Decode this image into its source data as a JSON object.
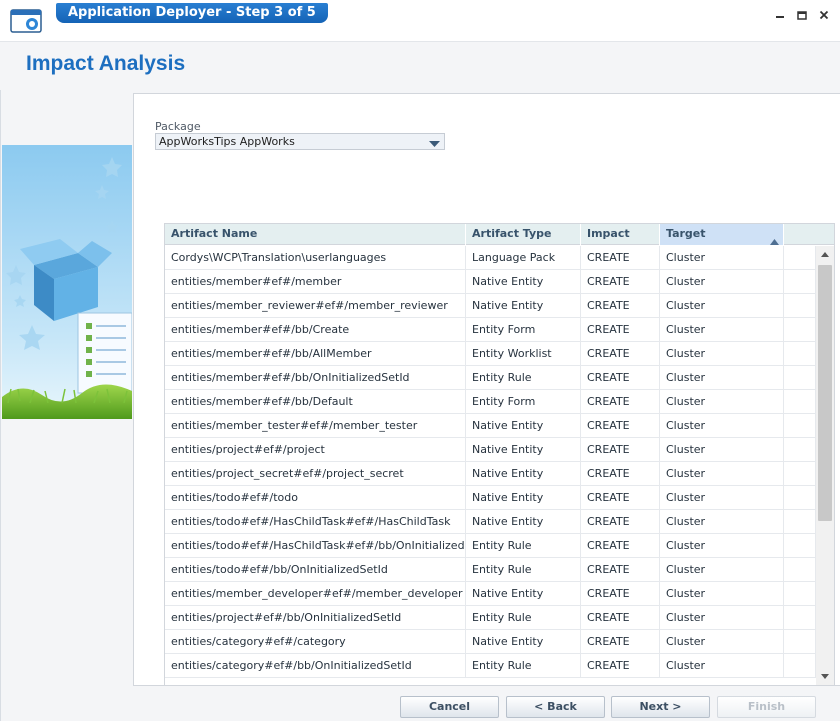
{
  "window": {
    "title": "Application Deployer - Step 3 of 5",
    "icon": "app-window-icon"
  },
  "page": {
    "title": "Impact Analysis"
  },
  "package": {
    "label": "Package",
    "value": "AppWorksTips AppWorks"
  },
  "table": {
    "columns": [
      "Artifact Name",
      "Artifact Type",
      "Impact",
      "Target"
    ],
    "sort": {
      "column": "Target",
      "direction": "ascending"
    },
    "rows": [
      [
        "Cordys\\WCP\\Translation\\userlanguages",
        "Language Pack",
        "CREATE",
        "Cluster"
      ],
      [
        "entities/member#ef#/member",
        "Native Entity",
        "CREATE",
        "Cluster"
      ],
      [
        "entities/member_reviewer#ef#/member_reviewer",
        "Native Entity",
        "CREATE",
        "Cluster"
      ],
      [
        "entities/member#ef#/bb/Create",
        "Entity Form",
        "CREATE",
        "Cluster"
      ],
      [
        "entities/member#ef#/bb/AllMember",
        "Entity Worklist",
        "CREATE",
        "Cluster"
      ],
      [
        "entities/member#ef#/bb/OnInitializedSetId",
        "Entity Rule",
        "CREATE",
        "Cluster"
      ],
      [
        "entities/member#ef#/bb/Default",
        "Entity Form",
        "CREATE",
        "Cluster"
      ],
      [
        "entities/member_tester#ef#/member_tester",
        "Native Entity",
        "CREATE",
        "Cluster"
      ],
      [
        "entities/project#ef#/project",
        "Native Entity",
        "CREATE",
        "Cluster"
      ],
      [
        "entities/project_secret#ef#/project_secret",
        "Native Entity",
        "CREATE",
        "Cluster"
      ],
      [
        "entities/todo#ef#/todo",
        "Native Entity",
        "CREATE",
        "Cluster"
      ],
      [
        "entities/todo#ef#/HasChildTask#ef#/HasChildTask",
        "Native Entity",
        "CREATE",
        "Cluster"
      ],
      [
        "entities/todo#ef#/HasChildTask#ef#/bb/OnInitializedSetId",
        "Entity Rule",
        "CREATE",
        "Cluster"
      ],
      [
        "entities/todo#ef#/bb/OnInitializedSetId",
        "Entity Rule",
        "CREATE",
        "Cluster"
      ],
      [
        "entities/member_developer#ef#/member_developer",
        "Native Entity",
        "CREATE",
        "Cluster"
      ],
      [
        "entities/project#ef#/bb/OnInitializedSetId",
        "Entity Rule",
        "CREATE",
        "Cluster"
      ],
      [
        "entities/category#ef#/category",
        "Native Entity",
        "CREATE",
        "Cluster"
      ],
      [
        "entities/category#ef#/bb/OnInitializedSetId",
        "Entity Rule",
        "CREATE",
        "Cluster"
      ]
    ]
  },
  "buttons": {
    "cancel": "Cancel",
    "back": "< Back",
    "next": "Next >",
    "finish": "Finish"
  },
  "colors": {
    "accent": "#1d6fc0",
    "title_tab": "#1463b6",
    "header_bg": "#e4eff0",
    "sorted_header_bg": "#cfe1f6"
  }
}
